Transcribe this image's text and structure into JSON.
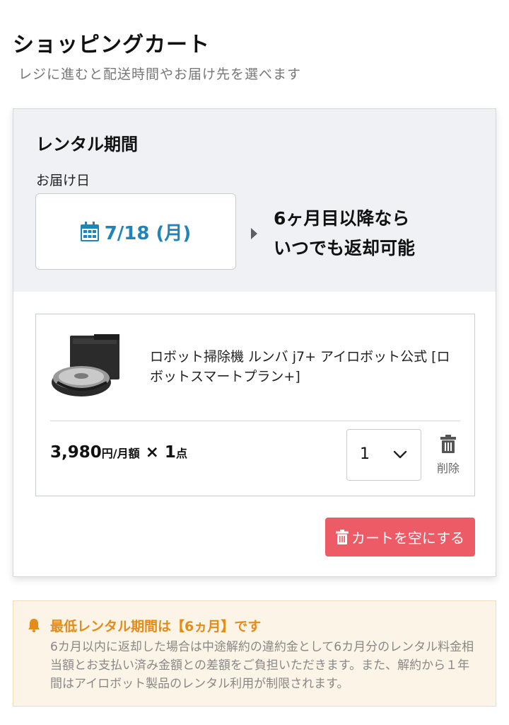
{
  "header": {
    "title": "ショッピングカート",
    "subtitle": "レジに進むと配送時間やお届け先を選べます"
  },
  "rental": {
    "title": "レンタル期間",
    "delivery_label": "お届け日",
    "delivery_date": "7/18 (月)",
    "return_note_line1": "6ヶ月目以降なら",
    "return_note_line2": "いつでも返却可能"
  },
  "item": {
    "name": "ロボット掃除機 ルンバ j7+ アイロボット公式 [ロボットスマートプラン+]",
    "price": "3,980",
    "price_unit": "円/月額",
    "times": " × ",
    "count": "1",
    "count_unit": "点",
    "quantity_selected": "1",
    "delete_label": "削除"
  },
  "actions": {
    "empty_cart_label": "カートを空にする"
  },
  "notice": {
    "title": "最低レンタル期間は【6ヵ月】です",
    "body": "6カ月以内に返却した場合は中途解約の違約金として6カ月分のレンタル料金相当額とお支払い済み金額との差額をご負担いただきます。また、解約から１年間はアイロボット製品のレンタル利用が制限されます。"
  },
  "colors": {
    "accent_blue": "#1f85b8",
    "danger_red": "#ec5b66",
    "notice_orange": "#e38c1a",
    "notice_bg": "#fcf4e6"
  },
  "icons": [
    "calendar-icon",
    "arrow-right-icon",
    "chevron-down-icon",
    "trash-icon",
    "bell-icon"
  ]
}
